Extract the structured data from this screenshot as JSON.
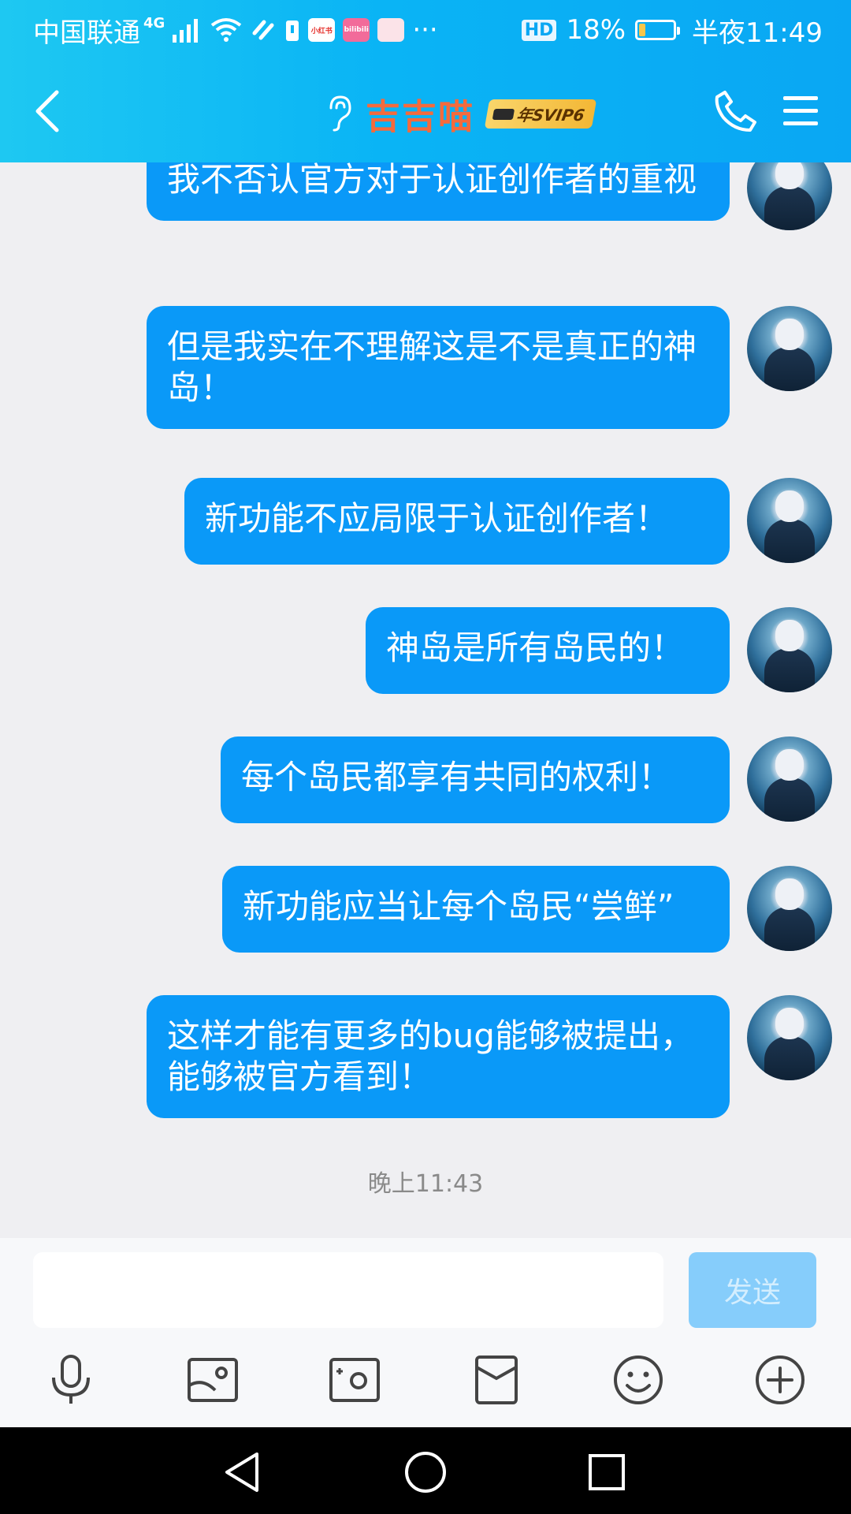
{
  "status_bar": {
    "carrier": "中国联通",
    "network_badge": "4G",
    "app_icon_1": "小红书",
    "app_icon_2": "bilibili",
    "more": "···",
    "hd": "HD",
    "battery_percent": "18%",
    "time": "半夜11:49"
  },
  "header": {
    "title": "吉吉喵",
    "badge": "年SVIP6",
    "icons": [
      "back-chevron-icon",
      "ear-icon",
      "phone-icon",
      "menu-icon"
    ]
  },
  "messages": [
    {
      "text": "我不否认官方对于认证创作者的重视",
      "sender": "me"
    },
    {
      "text": "但是我实在不理解这是不是真正的神岛！",
      "sender": "me"
    },
    {
      "text": "新功能不应局限于认证创作者！",
      "sender": "me"
    },
    {
      "text": "神岛是所有岛民的！",
      "sender": "me"
    },
    {
      "text": "每个岛民都享有共同的权利！",
      "sender": "me"
    },
    {
      "text": "新功能应当让每个岛民“尝鲜”",
      "sender": "me"
    },
    {
      "text": "这样才能有更多的bug能够被提出，能够被官方看到！",
      "sender": "me"
    }
  ],
  "timestamp": "晚上11:43",
  "input": {
    "value": "",
    "placeholder": "",
    "send_label": "发送"
  },
  "toolbar_icons": [
    "microphone-icon",
    "image-icon",
    "camera-icon",
    "red-packet-icon",
    "emoji-icon",
    "plus-icon"
  ],
  "nav_icons": [
    "back-triangle-icon",
    "home-circle-icon",
    "recent-square-icon"
  ],
  "colors": {
    "header": "#0ab4f5",
    "bubble": "#0a99f8",
    "title": "#f56a3c",
    "send_disabled": "#86cdfb"
  }
}
